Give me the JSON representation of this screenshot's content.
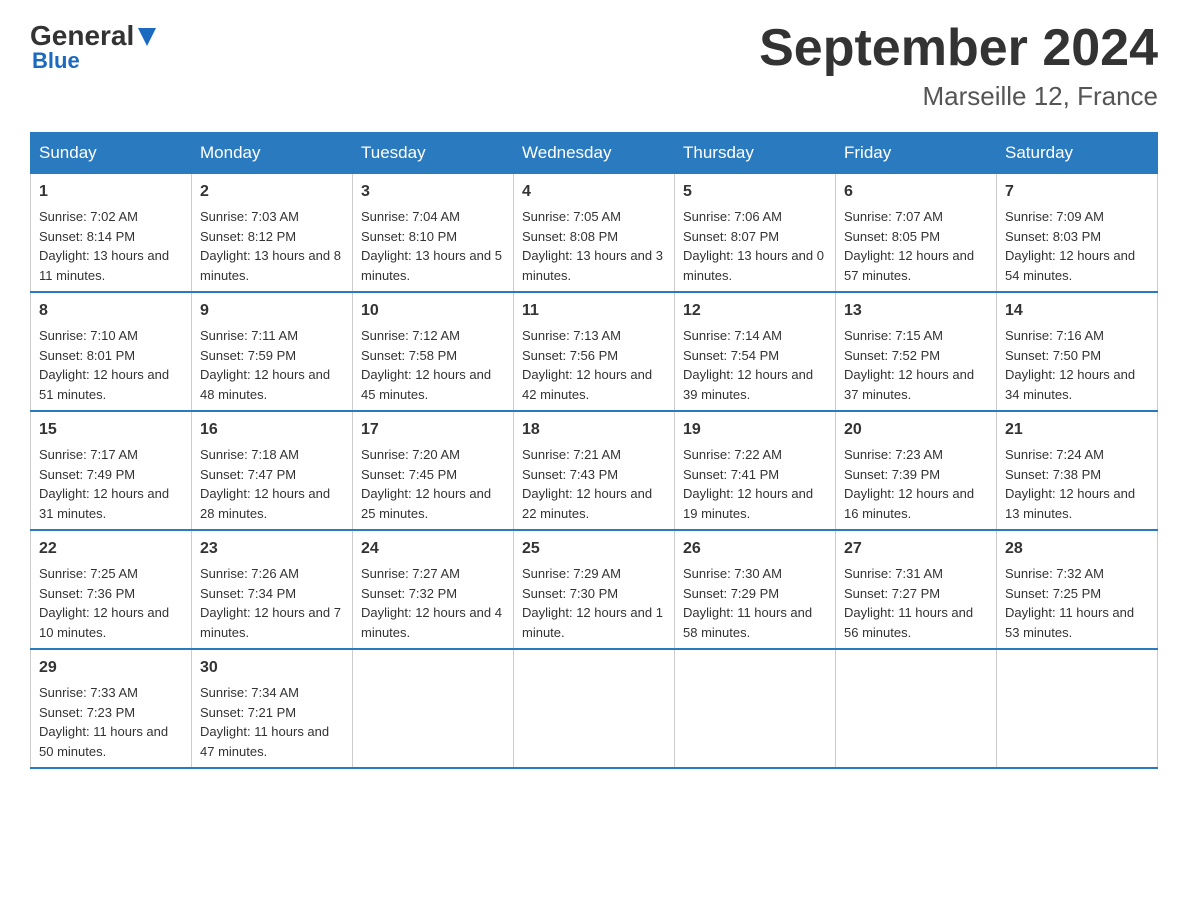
{
  "header": {
    "logo_general": "General",
    "logo_blue": "Blue",
    "month_title": "September 2024",
    "location": "Marseille 12, France"
  },
  "days_of_week": [
    "Sunday",
    "Monday",
    "Tuesday",
    "Wednesday",
    "Thursday",
    "Friday",
    "Saturday"
  ],
  "weeks": [
    [
      {
        "day": "1",
        "sunrise": "Sunrise: 7:02 AM",
        "sunset": "Sunset: 8:14 PM",
        "daylight": "Daylight: 13 hours and 11 minutes."
      },
      {
        "day": "2",
        "sunrise": "Sunrise: 7:03 AM",
        "sunset": "Sunset: 8:12 PM",
        "daylight": "Daylight: 13 hours and 8 minutes."
      },
      {
        "day": "3",
        "sunrise": "Sunrise: 7:04 AM",
        "sunset": "Sunset: 8:10 PM",
        "daylight": "Daylight: 13 hours and 5 minutes."
      },
      {
        "day": "4",
        "sunrise": "Sunrise: 7:05 AM",
        "sunset": "Sunset: 8:08 PM",
        "daylight": "Daylight: 13 hours and 3 minutes."
      },
      {
        "day": "5",
        "sunrise": "Sunrise: 7:06 AM",
        "sunset": "Sunset: 8:07 PM",
        "daylight": "Daylight: 13 hours and 0 minutes."
      },
      {
        "day": "6",
        "sunrise": "Sunrise: 7:07 AM",
        "sunset": "Sunset: 8:05 PM",
        "daylight": "Daylight: 12 hours and 57 minutes."
      },
      {
        "day": "7",
        "sunrise": "Sunrise: 7:09 AM",
        "sunset": "Sunset: 8:03 PM",
        "daylight": "Daylight: 12 hours and 54 minutes."
      }
    ],
    [
      {
        "day": "8",
        "sunrise": "Sunrise: 7:10 AM",
        "sunset": "Sunset: 8:01 PM",
        "daylight": "Daylight: 12 hours and 51 minutes."
      },
      {
        "day": "9",
        "sunrise": "Sunrise: 7:11 AM",
        "sunset": "Sunset: 7:59 PM",
        "daylight": "Daylight: 12 hours and 48 minutes."
      },
      {
        "day": "10",
        "sunrise": "Sunrise: 7:12 AM",
        "sunset": "Sunset: 7:58 PM",
        "daylight": "Daylight: 12 hours and 45 minutes."
      },
      {
        "day": "11",
        "sunrise": "Sunrise: 7:13 AM",
        "sunset": "Sunset: 7:56 PM",
        "daylight": "Daylight: 12 hours and 42 minutes."
      },
      {
        "day": "12",
        "sunrise": "Sunrise: 7:14 AM",
        "sunset": "Sunset: 7:54 PM",
        "daylight": "Daylight: 12 hours and 39 minutes."
      },
      {
        "day": "13",
        "sunrise": "Sunrise: 7:15 AM",
        "sunset": "Sunset: 7:52 PM",
        "daylight": "Daylight: 12 hours and 37 minutes."
      },
      {
        "day": "14",
        "sunrise": "Sunrise: 7:16 AM",
        "sunset": "Sunset: 7:50 PM",
        "daylight": "Daylight: 12 hours and 34 minutes."
      }
    ],
    [
      {
        "day": "15",
        "sunrise": "Sunrise: 7:17 AM",
        "sunset": "Sunset: 7:49 PM",
        "daylight": "Daylight: 12 hours and 31 minutes."
      },
      {
        "day": "16",
        "sunrise": "Sunrise: 7:18 AM",
        "sunset": "Sunset: 7:47 PM",
        "daylight": "Daylight: 12 hours and 28 minutes."
      },
      {
        "day": "17",
        "sunrise": "Sunrise: 7:20 AM",
        "sunset": "Sunset: 7:45 PM",
        "daylight": "Daylight: 12 hours and 25 minutes."
      },
      {
        "day": "18",
        "sunrise": "Sunrise: 7:21 AM",
        "sunset": "Sunset: 7:43 PM",
        "daylight": "Daylight: 12 hours and 22 minutes."
      },
      {
        "day": "19",
        "sunrise": "Sunrise: 7:22 AM",
        "sunset": "Sunset: 7:41 PM",
        "daylight": "Daylight: 12 hours and 19 minutes."
      },
      {
        "day": "20",
        "sunrise": "Sunrise: 7:23 AM",
        "sunset": "Sunset: 7:39 PM",
        "daylight": "Daylight: 12 hours and 16 minutes."
      },
      {
        "day": "21",
        "sunrise": "Sunrise: 7:24 AM",
        "sunset": "Sunset: 7:38 PM",
        "daylight": "Daylight: 12 hours and 13 minutes."
      }
    ],
    [
      {
        "day": "22",
        "sunrise": "Sunrise: 7:25 AM",
        "sunset": "Sunset: 7:36 PM",
        "daylight": "Daylight: 12 hours and 10 minutes."
      },
      {
        "day": "23",
        "sunrise": "Sunrise: 7:26 AM",
        "sunset": "Sunset: 7:34 PM",
        "daylight": "Daylight: 12 hours and 7 minutes."
      },
      {
        "day": "24",
        "sunrise": "Sunrise: 7:27 AM",
        "sunset": "Sunset: 7:32 PM",
        "daylight": "Daylight: 12 hours and 4 minutes."
      },
      {
        "day": "25",
        "sunrise": "Sunrise: 7:29 AM",
        "sunset": "Sunset: 7:30 PM",
        "daylight": "Daylight: 12 hours and 1 minute."
      },
      {
        "day": "26",
        "sunrise": "Sunrise: 7:30 AM",
        "sunset": "Sunset: 7:29 PM",
        "daylight": "Daylight: 11 hours and 58 minutes."
      },
      {
        "day": "27",
        "sunrise": "Sunrise: 7:31 AM",
        "sunset": "Sunset: 7:27 PM",
        "daylight": "Daylight: 11 hours and 56 minutes."
      },
      {
        "day": "28",
        "sunrise": "Sunrise: 7:32 AM",
        "sunset": "Sunset: 7:25 PM",
        "daylight": "Daylight: 11 hours and 53 minutes."
      }
    ],
    [
      {
        "day": "29",
        "sunrise": "Sunrise: 7:33 AM",
        "sunset": "Sunset: 7:23 PM",
        "daylight": "Daylight: 11 hours and 50 minutes."
      },
      {
        "day": "30",
        "sunrise": "Sunrise: 7:34 AM",
        "sunset": "Sunset: 7:21 PM",
        "daylight": "Daylight: 11 hours and 47 minutes."
      },
      null,
      null,
      null,
      null,
      null
    ]
  ]
}
